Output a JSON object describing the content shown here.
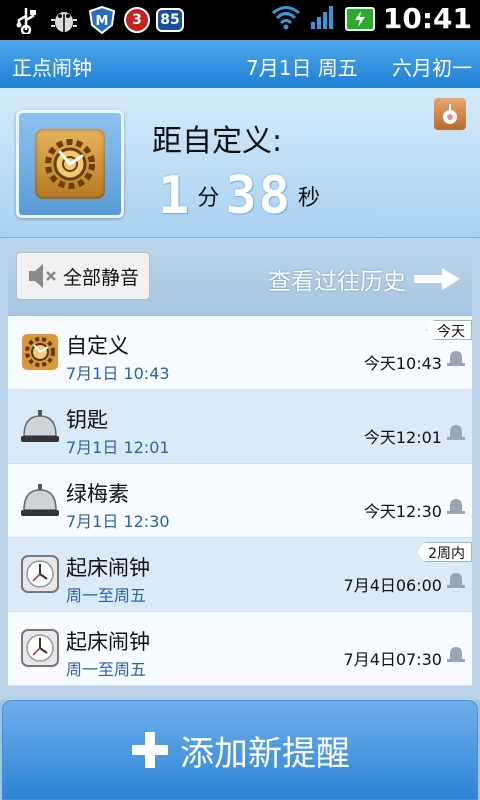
{
  "status_bar": {
    "badge_1": "3",
    "badge_2": "85",
    "time": "10:41"
  },
  "title_bar": {
    "app_name": "正点闹钟",
    "date": "7月1日 周五",
    "lunar_date": "六月初一"
  },
  "header": {
    "label": "距自定义:",
    "minutes": "1",
    "minutes_unit": "分",
    "seconds": "38",
    "seconds_unit": "秒"
  },
  "toolbar": {
    "mute_all_label": "全部静音",
    "history_label": "查看过往历史"
  },
  "alarms": [
    {
      "name": "自定义",
      "date": "7月1日 10:43",
      "when": "今天10:43",
      "tag": "今天",
      "icon": "gear-clock-icon"
    },
    {
      "name": "钥匙",
      "date": "7月1日 12:01",
      "when": "今天12:01",
      "tag": "",
      "icon": "desk-bell-icon"
    },
    {
      "name": "绿梅素",
      "date": "7月1日 12:30",
      "when": "今天12:30",
      "tag": "",
      "icon": "desk-bell-icon"
    },
    {
      "name": "起床闹钟",
      "date": "周一至周五",
      "when": "7月4日06:00",
      "tag": "2周内",
      "icon": "wall-clock-icon"
    },
    {
      "name": "起床闹钟",
      "date": "周一至周五",
      "when": "7月4日07:30",
      "tag": "",
      "icon": "wall-clock-icon"
    }
  ],
  "add_button_label": "添加新提醒",
  "colors": {
    "title_bar": "#2f8fe0",
    "date_text": "#2e62a5",
    "add_button": "#3f92dc"
  }
}
